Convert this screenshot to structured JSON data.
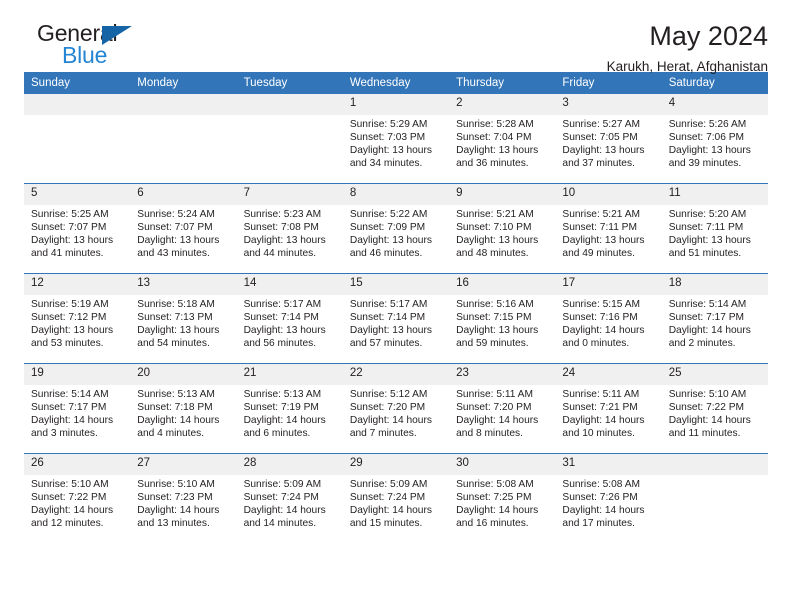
{
  "brand": {
    "name_part1": "General",
    "name_part2": "Blue",
    "triangle_color": "#1565a6",
    "blue_color": "#2585d3"
  },
  "header": {
    "title": "May 2024",
    "subtitle": "Karukh, Herat, Afghanistan"
  },
  "theme": {
    "header_bg": "#3275b8",
    "daynum_bg": "#f0f0f0",
    "text": "#231f20"
  },
  "weekdays": [
    "Sunday",
    "Monday",
    "Tuesday",
    "Wednesday",
    "Thursday",
    "Friday",
    "Saturday"
  ],
  "labels": {
    "sunrise_prefix": "Sunrise:",
    "sunset_prefix": "Sunset:",
    "daylight_prefix": "Daylight:"
  },
  "weeks": [
    [
      {
        "day": "",
        "empty": true
      },
      {
        "day": "",
        "empty": true
      },
      {
        "day": "",
        "empty": true
      },
      {
        "day": "1",
        "sunrise": "Sunrise: 5:29 AM",
        "sunset": "Sunset: 7:03 PM",
        "daylight_l1": "Daylight: 13 hours",
        "daylight_l2": "and 34 minutes."
      },
      {
        "day": "2",
        "sunrise": "Sunrise: 5:28 AM",
        "sunset": "Sunset: 7:04 PM",
        "daylight_l1": "Daylight: 13 hours",
        "daylight_l2": "and 36 minutes."
      },
      {
        "day": "3",
        "sunrise": "Sunrise: 5:27 AM",
        "sunset": "Sunset: 7:05 PM",
        "daylight_l1": "Daylight: 13 hours",
        "daylight_l2": "and 37 minutes."
      },
      {
        "day": "4",
        "sunrise": "Sunrise: 5:26 AM",
        "sunset": "Sunset: 7:06 PM",
        "daylight_l1": "Daylight: 13 hours",
        "daylight_l2": "and 39 minutes."
      }
    ],
    [
      {
        "day": "5",
        "sunrise": "Sunrise: 5:25 AM",
        "sunset": "Sunset: 7:07 PM",
        "daylight_l1": "Daylight: 13 hours",
        "daylight_l2": "and 41 minutes."
      },
      {
        "day": "6",
        "sunrise": "Sunrise: 5:24 AM",
        "sunset": "Sunset: 7:07 PM",
        "daylight_l1": "Daylight: 13 hours",
        "daylight_l2": "and 43 minutes."
      },
      {
        "day": "7",
        "sunrise": "Sunrise: 5:23 AM",
        "sunset": "Sunset: 7:08 PM",
        "daylight_l1": "Daylight: 13 hours",
        "daylight_l2": "and 44 minutes."
      },
      {
        "day": "8",
        "sunrise": "Sunrise: 5:22 AM",
        "sunset": "Sunset: 7:09 PM",
        "daylight_l1": "Daylight: 13 hours",
        "daylight_l2": "and 46 minutes."
      },
      {
        "day": "9",
        "sunrise": "Sunrise: 5:21 AM",
        "sunset": "Sunset: 7:10 PM",
        "daylight_l1": "Daylight: 13 hours",
        "daylight_l2": "and 48 minutes."
      },
      {
        "day": "10",
        "sunrise": "Sunrise: 5:21 AM",
        "sunset": "Sunset: 7:11 PM",
        "daylight_l1": "Daylight: 13 hours",
        "daylight_l2": "and 49 minutes."
      },
      {
        "day": "11",
        "sunrise": "Sunrise: 5:20 AM",
        "sunset": "Sunset: 7:11 PM",
        "daylight_l1": "Daylight: 13 hours",
        "daylight_l2": "and 51 minutes."
      }
    ],
    [
      {
        "day": "12",
        "sunrise": "Sunrise: 5:19 AM",
        "sunset": "Sunset: 7:12 PM",
        "daylight_l1": "Daylight: 13 hours",
        "daylight_l2": "and 53 minutes."
      },
      {
        "day": "13",
        "sunrise": "Sunrise: 5:18 AM",
        "sunset": "Sunset: 7:13 PM",
        "daylight_l1": "Daylight: 13 hours",
        "daylight_l2": "and 54 minutes."
      },
      {
        "day": "14",
        "sunrise": "Sunrise: 5:17 AM",
        "sunset": "Sunset: 7:14 PM",
        "daylight_l1": "Daylight: 13 hours",
        "daylight_l2": "and 56 minutes."
      },
      {
        "day": "15",
        "sunrise": "Sunrise: 5:17 AM",
        "sunset": "Sunset: 7:14 PM",
        "daylight_l1": "Daylight: 13 hours",
        "daylight_l2": "and 57 minutes."
      },
      {
        "day": "16",
        "sunrise": "Sunrise: 5:16 AM",
        "sunset": "Sunset: 7:15 PM",
        "daylight_l1": "Daylight: 13 hours",
        "daylight_l2": "and 59 minutes."
      },
      {
        "day": "17",
        "sunrise": "Sunrise: 5:15 AM",
        "sunset": "Sunset: 7:16 PM",
        "daylight_l1": "Daylight: 14 hours",
        "daylight_l2": "and 0 minutes."
      },
      {
        "day": "18",
        "sunrise": "Sunrise: 5:14 AM",
        "sunset": "Sunset: 7:17 PM",
        "daylight_l1": "Daylight: 14 hours",
        "daylight_l2": "and 2 minutes."
      }
    ],
    [
      {
        "day": "19",
        "sunrise": "Sunrise: 5:14 AM",
        "sunset": "Sunset: 7:17 PM",
        "daylight_l1": "Daylight: 14 hours",
        "daylight_l2": "and 3 minutes."
      },
      {
        "day": "20",
        "sunrise": "Sunrise: 5:13 AM",
        "sunset": "Sunset: 7:18 PM",
        "daylight_l1": "Daylight: 14 hours",
        "daylight_l2": "and 4 minutes."
      },
      {
        "day": "21",
        "sunrise": "Sunrise: 5:13 AM",
        "sunset": "Sunset: 7:19 PM",
        "daylight_l1": "Daylight: 14 hours",
        "daylight_l2": "and 6 minutes."
      },
      {
        "day": "22",
        "sunrise": "Sunrise: 5:12 AM",
        "sunset": "Sunset: 7:20 PM",
        "daylight_l1": "Daylight: 14 hours",
        "daylight_l2": "and 7 minutes."
      },
      {
        "day": "23",
        "sunrise": "Sunrise: 5:11 AM",
        "sunset": "Sunset: 7:20 PM",
        "daylight_l1": "Daylight: 14 hours",
        "daylight_l2": "and 8 minutes."
      },
      {
        "day": "24",
        "sunrise": "Sunrise: 5:11 AM",
        "sunset": "Sunset: 7:21 PM",
        "daylight_l1": "Daylight: 14 hours",
        "daylight_l2": "and 10 minutes."
      },
      {
        "day": "25",
        "sunrise": "Sunrise: 5:10 AM",
        "sunset": "Sunset: 7:22 PM",
        "daylight_l1": "Daylight: 14 hours",
        "daylight_l2": "and 11 minutes."
      }
    ],
    [
      {
        "day": "26",
        "sunrise": "Sunrise: 5:10 AM",
        "sunset": "Sunset: 7:22 PM",
        "daylight_l1": "Daylight: 14 hours",
        "daylight_l2": "and 12 minutes."
      },
      {
        "day": "27",
        "sunrise": "Sunrise: 5:10 AM",
        "sunset": "Sunset: 7:23 PM",
        "daylight_l1": "Daylight: 14 hours",
        "daylight_l2": "and 13 minutes."
      },
      {
        "day": "28",
        "sunrise": "Sunrise: 5:09 AM",
        "sunset": "Sunset: 7:24 PM",
        "daylight_l1": "Daylight: 14 hours",
        "daylight_l2": "and 14 minutes."
      },
      {
        "day": "29",
        "sunrise": "Sunrise: 5:09 AM",
        "sunset": "Sunset: 7:24 PM",
        "daylight_l1": "Daylight: 14 hours",
        "daylight_l2": "and 15 minutes."
      },
      {
        "day": "30",
        "sunrise": "Sunrise: 5:08 AM",
        "sunset": "Sunset: 7:25 PM",
        "daylight_l1": "Daylight: 14 hours",
        "daylight_l2": "and 16 minutes."
      },
      {
        "day": "31",
        "sunrise": "Sunrise: 5:08 AM",
        "sunset": "Sunset: 7:26 PM",
        "daylight_l1": "Daylight: 14 hours",
        "daylight_l2": "and 17 minutes."
      },
      {
        "day": "",
        "empty": true
      }
    ]
  ]
}
